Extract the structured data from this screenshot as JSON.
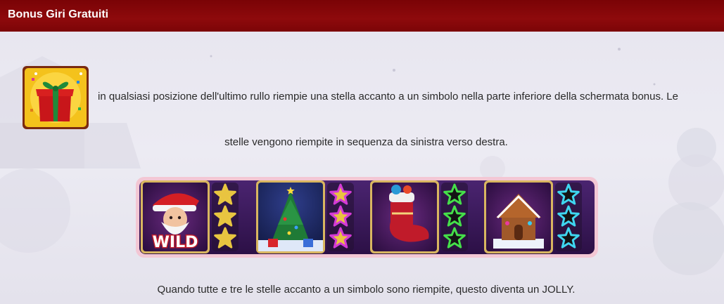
{
  "header": {
    "title": "Bonus Giri Gratuiti"
  },
  "description": {
    "icon": "gift-icon",
    "line1": "in qualsiasi posizione dell'ultimo rullo riempie una stella accanto a un simbolo nella parte inferiore della schermata bonus. Le",
    "line2": "stelle vengono riempite in sequenza da sinistra verso destra."
  },
  "bonus_panel": {
    "symbols": [
      {
        "icon": "santa-wild-icon",
        "label": "WILD",
        "star_color": "#e8c640",
        "stars_filled": 3
      },
      {
        "icon": "christmas-tree-icon",
        "star_color": "#d33ad6",
        "stars_filled": 3
      },
      {
        "icon": "christmas-stocking-icon",
        "star_color": "#45e04a",
        "stars_filled": 0
      },
      {
        "icon": "gingerbread-house-icon",
        "star_color": "#3fd6f0",
        "stars_filled": 0
      }
    ],
    "colors": {
      "panel_bg": "#3c1a5e",
      "panel_border": "#f0b9c9"
    }
  },
  "footer": {
    "text": "Quando tutte e tre le stelle accanto a un simbolo sono riempite, questo diventa un JOLLY."
  }
}
